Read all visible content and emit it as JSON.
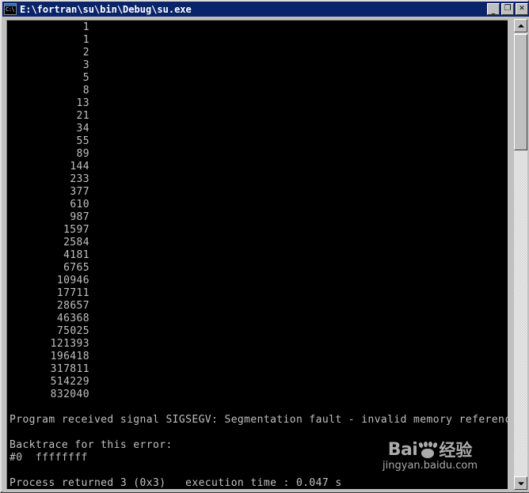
{
  "window": {
    "title": "E:\\fortran\\su\\bin\\Debug\\su.exe",
    "icon_name": "console-icon",
    "icon_label": "C:\\",
    "controls": {
      "minimize_label": "_",
      "maximize_label": "❐",
      "close_label": "✕"
    },
    "titlebar_color": "#0a246a",
    "frame_color": "#c0c0c0",
    "console_bg": "#000000",
    "console_fg": "#c0c0c0"
  },
  "console": {
    "number_lines": [
      "1",
      "1",
      "2",
      "3",
      "5",
      "8",
      "13",
      "21",
      "34",
      "55",
      "89",
      "144",
      "233",
      "377",
      "610",
      "987",
      "1597",
      "2584",
      "4181",
      "6765",
      "10946",
      "17711",
      "28657",
      "46368",
      "75025",
      "121393",
      "196418",
      "317811",
      "514229",
      "832040"
    ],
    "error_signal_line": "Program received signal SIGSEGV: Segmentation fault - invalid memory reference.",
    "backtrace_header": "Backtrace for this error:",
    "backtrace_frame_0": "#0  ffffffff",
    "process_return_line": "Process returned 3 (0x3)   execution time : 0.047 s"
  },
  "scrollbar": {
    "up_arrow": "scroll-up-arrow",
    "down_arrow": "scroll-down-arrow",
    "thumb": "scroll-thumb"
  },
  "watermark": {
    "brand_latin": "Bai",
    "brand_cn": "经验",
    "url": "jingyan.baidu.com"
  }
}
